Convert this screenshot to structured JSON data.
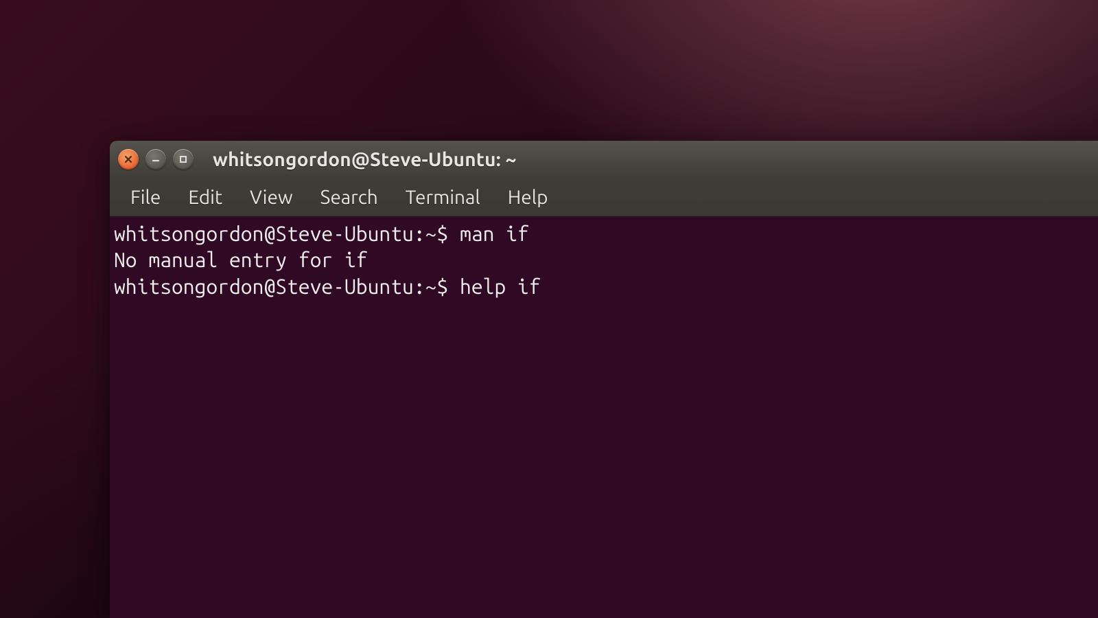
{
  "window": {
    "title": "whitsongordon@Steve-Ubuntu: ~"
  },
  "menubar": {
    "items": [
      "File",
      "Edit",
      "View",
      "Search",
      "Terminal",
      "Help"
    ]
  },
  "terminal": {
    "prompt": "whitsongordon@Steve-Ubuntu:~$",
    "lines": [
      {
        "prompt": "whitsongordon@Steve-Ubuntu:~$",
        "command": "man if"
      },
      {
        "output": "No manual entry for if"
      },
      {
        "prompt": "whitsongordon@Steve-Ubuntu:~$",
        "command": "help if"
      }
    ]
  },
  "colors": {
    "terminal_bg": "#300a24",
    "terminal_fg": "#eeeeec",
    "close_button": "#e8632f"
  }
}
